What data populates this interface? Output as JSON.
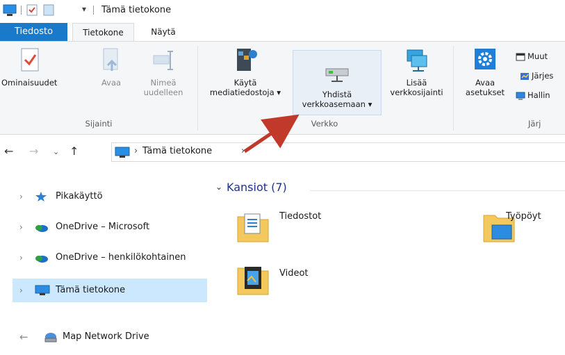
{
  "title": "Tämä tietokone",
  "tabs": {
    "file": "Tiedosto",
    "computer": "Tietokone",
    "view": "Näytä"
  },
  "ribbon": {
    "location_group": {
      "label": "Sijainti",
      "properties": "Ominaisuudet",
      "open": "Avaa",
      "rename_1": "Nimeä",
      "rename_2": "uudelleen"
    },
    "network_group": {
      "label": "Verkko",
      "media_1": "Käytä",
      "media_2": "mediatiedostoja ▾",
      "map_1": "Yhdistä",
      "map_2": "verkkoasemaan ▾",
      "add_1": "Lisää",
      "add_2": "verkkosijainti"
    },
    "system_group": {
      "label": "Järj",
      "settings_1": "Avaa",
      "settings_2": "asetukset",
      "small_1": "Muut",
      "small_2": "Järjes",
      "small_3": "Hallin"
    }
  },
  "address": {
    "path": "Tämä tietokone"
  },
  "nav_pane": [
    {
      "label": "Pikakäyttö"
    },
    {
      "label": "OneDrive – Microsoft"
    },
    {
      "label": "OneDrive – henkilökohtainen"
    },
    {
      "label": "Tämä tietokone"
    }
  ],
  "content": {
    "section": "Kansiot (7)",
    "items": [
      {
        "name": "Tiedostot"
      },
      {
        "name": "Työpöyt"
      },
      {
        "name": "Videot"
      }
    ]
  },
  "footer": {
    "label": "Map Network Drive"
  },
  "colors": {
    "accent": "#1979ca",
    "selected": "#cce8ff",
    "arrow": "#c0392b"
  }
}
